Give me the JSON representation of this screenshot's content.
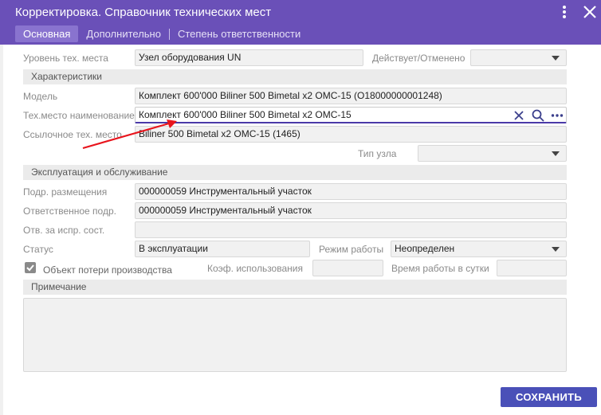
{
  "window": {
    "title": "Корректировка. Справочник технических мест",
    "menu_icon": "more-vert-icon",
    "close_icon": "close-icon"
  },
  "tabs": [
    {
      "label": "Основная",
      "active": true
    },
    {
      "label": "Дополнительно",
      "active": false
    },
    {
      "label": "Степень ответственности",
      "active": false
    }
  ],
  "form": {
    "level_label": "Уровень тех. места",
    "level_value": "Узел оборудования UN",
    "active_label": "Действует/Отменено",
    "active_value": "",
    "section_characteristics": "Характеристики",
    "model_label": "Модель",
    "model_value": "Комплект 600'000 Biliner 500 Bimetal x2 OMC-15 (O18000000001248)",
    "name_label": "Тех.место наименование",
    "name_value": "Комплект 600'000 Biliner 500 Bimetal x2 OMC-15",
    "ref_label": "Ссылочное тех. место",
    "ref_value": "Biliner 500 Bimetal x2 OMC-15 (1465)",
    "node_type_label": "Тип узла",
    "node_type_value": "",
    "section_operation": "Эксплуатация и обслуживание",
    "placement_label": "Подр. размещения",
    "placement_value": "000000059 Инструментальный участок",
    "responsible_label": "Ответственное подр.",
    "responsible_value": "000000059 Инструментальный участок",
    "condition_label": "Отв. за испр. сост.",
    "condition_value": "",
    "status_label": "Статус",
    "status_value": "В эксплуатации",
    "mode_label": "Режим работы",
    "mode_value": "Неопределен",
    "loss_object_label": "Объект потери производства",
    "loss_object_checked": true,
    "usage_coef_label": "Коэф. использования",
    "usage_coef_value": "",
    "daily_hours_label": "Время работы в сутки",
    "daily_hours_value": "",
    "section_note": "Примечание",
    "note_value": ""
  },
  "actions": {
    "save_label": "СОХРАНИТЬ"
  },
  "colors": {
    "header": "#6a50b8",
    "active_tab": "#8973cf",
    "save_button": "#4a50b8",
    "annotation_arrow": "#e8141c"
  }
}
